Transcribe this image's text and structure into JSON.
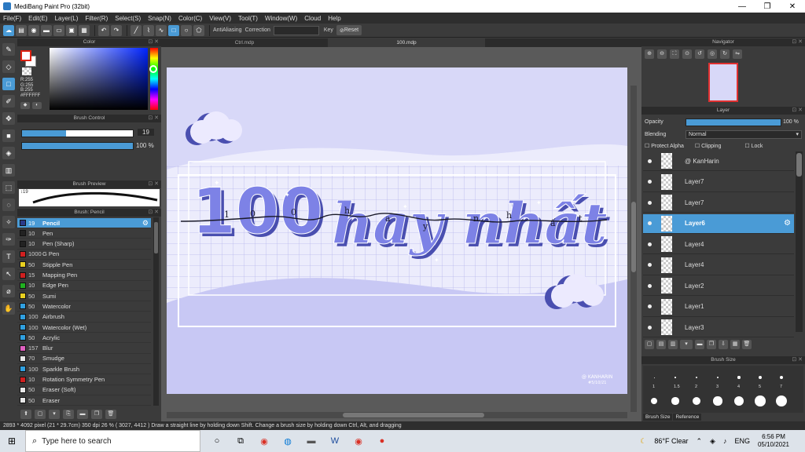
{
  "window": {
    "title": "MediBang Paint Pro (32bit)",
    "minimize": "—",
    "maximize": "❐",
    "close": "✕"
  },
  "menu": [
    "File(F)",
    "Edit(E)",
    "Layer(L)",
    "Filter(R)",
    "Select(S)",
    "Snap(N)",
    "Color(C)",
    "View(V)",
    "Tool(T)",
    "Window(W)",
    "Cloud",
    "Help"
  ],
  "toolbar": {
    "antialias_label": "AntiAliasing",
    "correction_label": "Correction",
    "key_label": "Key",
    "reset_label": "Reset"
  },
  "color_panel": {
    "title": "Color",
    "r": "R:255",
    "g": "G:255",
    "b": "B:255",
    "hex": "#FFFFFF"
  },
  "brush_control": {
    "title": "Brush Control",
    "size": "19",
    "opacity": "100 %"
  },
  "brush_preview": {
    "title": "Brush Preview",
    "size_tag": "↕19"
  },
  "brush_list": {
    "title": "Brush: Pencil",
    "items": [
      {
        "size": "19",
        "name": "Pencil",
        "color": "#2b3b8a"
      },
      {
        "size": "10",
        "name": "Pen",
        "color": "#222222"
      },
      {
        "size": "10",
        "name": "Pen (Sharp)",
        "color": "#222222"
      },
      {
        "size": "1000",
        "name": "G Pen",
        "color": "#d02020"
      },
      {
        "size": "50",
        "name": "Stipple Pen",
        "color": "#e8d020"
      },
      {
        "size": "15",
        "name": "Mapping Pen",
        "color": "#d02020"
      },
      {
        "size": "10",
        "name": "Edge Pen",
        "color": "#20b020"
      },
      {
        "size": "50",
        "name": "Sumi",
        "color": "#e8d020"
      },
      {
        "size": "50",
        "name": "Watercolor",
        "color": "#30a0e0"
      },
      {
        "size": "100",
        "name": "Airbrush",
        "color": "#30a0e0"
      },
      {
        "size": "100",
        "name": "Watercolor (Wet)",
        "color": "#30a0e0"
      },
      {
        "size": "50",
        "name": "Acrylic",
        "color": "#30a0e0"
      },
      {
        "size": "157",
        "name": "Blur",
        "color": "#e060c0"
      },
      {
        "size": "70",
        "name": "Smudge",
        "color": "#e8e8e8"
      },
      {
        "size": "100",
        "name": "Sparkle Brush",
        "color": "#30a0e0"
      },
      {
        "size": "10",
        "name": "Rotation Symmetry Pen",
        "color": "#d02020"
      },
      {
        "size": "50",
        "name": "Eraser (Soft)",
        "color": "#e8e8e8"
      },
      {
        "size": "50",
        "name": "Eraser",
        "color": "#e8e8e8"
      }
    ]
  },
  "tabs": [
    "Ctrl.mdp",
    "100.mdp"
  ],
  "canvas": {
    "big_text": "100",
    "script_text": "hay nhất",
    "line_letters": [
      "1",
      "0",
      "0",
      "h",
      "a",
      "y",
      "n",
      "h",
      "ấ",
      "t"
    ],
    "signature": "@ KANHARIN",
    "signature_date": "#5/10/21",
    "colors": {
      "bg": "#d8d8f8",
      "grid": "#b8b8ec",
      "text_main": "#7d82e6",
      "text_shadow": "#4a4fb0",
      "line": "#1a1a2a"
    }
  },
  "navigator": {
    "title": "Navigator"
  },
  "layer_panel": {
    "title": "Layer",
    "opacity_label": "Opacity",
    "opacity_value": "100 %",
    "blending_label": "Blending",
    "blending_value": "Normal",
    "protect_alpha": "Protect Alpha",
    "clipping": "Clipping",
    "lock": "Lock",
    "layers": [
      "@ KanHarin",
      "Layer7",
      "Layer7",
      "Layer6",
      "Layer4",
      "Layer4",
      "Layer2",
      "Layer1",
      "Layer3"
    ],
    "selected_index": 3
  },
  "brush_size": {
    "title": "Brush Size",
    "labels": [
      "1",
      "1.5",
      "2",
      "3",
      "4",
      "5",
      "7"
    ],
    "tabs": [
      "Brush Size",
      "Reference"
    ]
  },
  "status": {
    "text": "2893 * 4092 pixel  (21 * 29.7cm)  350 dpi  26 %  ( 3027, 4412 )  Draw a straight line by holding down Shift. Change a brush size by holding down Ctrl, Alt, and dragging"
  },
  "taskbar": {
    "search_placeholder": "Type here to search",
    "weather": "86°F  Clear",
    "lang": "ENG",
    "time": "6:56 PM",
    "date": "05/10/2021"
  }
}
